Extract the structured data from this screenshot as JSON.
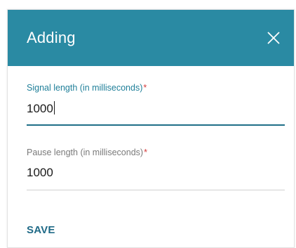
{
  "dialog": {
    "title": "Adding",
    "close_icon": "close-icon"
  },
  "fields": [
    {
      "label": "Signal length (in milliseconds)",
      "required_mark": "*",
      "value": "1000",
      "focused": true
    },
    {
      "label": "Pause length (in milliseconds)",
      "required_mark": "*",
      "value": "1000",
      "focused": false
    }
  ],
  "actions": {
    "save_label": "SAVE"
  },
  "colors": {
    "header": "#2a8aa3",
    "accent": "#1f7f99",
    "required": "#d43b3b"
  }
}
